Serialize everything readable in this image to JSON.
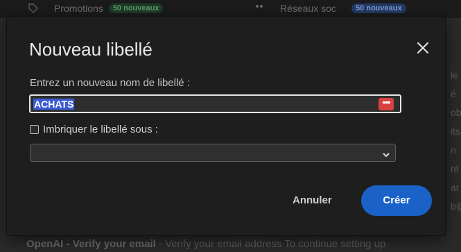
{
  "background": {
    "tabs": [
      {
        "label": "Promotions",
        "badge": "50 nouveaux",
        "icon": "tag-icon"
      },
      {
        "label": "Réseaux soc",
        "badge": "50 nouveaux",
        "icon": "people-icon"
      }
    ],
    "right_fragments": [
      "le",
      "é",
      "ob",
      "its",
      "n",
      "ré",
      "ar",
      "b@"
    ],
    "bottom_email": {
      "sender": "OpenAI",
      "subject": "Verify your email",
      "snippet": " - Verify your email address To continue setting up"
    }
  },
  "dialog": {
    "title": "Nouveau libellé",
    "name_label": "Entrez un nouveau nom de libellé :",
    "name_value": "ACHATS",
    "password_manager_glyph": "•••",
    "nest_label": "Imbriquer le libellé sous :",
    "nest_checked": false,
    "parent_select_value": "",
    "cancel_label": "Annuler",
    "create_label": "Créer"
  },
  "colors": {
    "accent": "#1a62c7",
    "badge_green": "#1f3b28",
    "badge_blue": "#243a63",
    "password_manager": "#d94040"
  }
}
